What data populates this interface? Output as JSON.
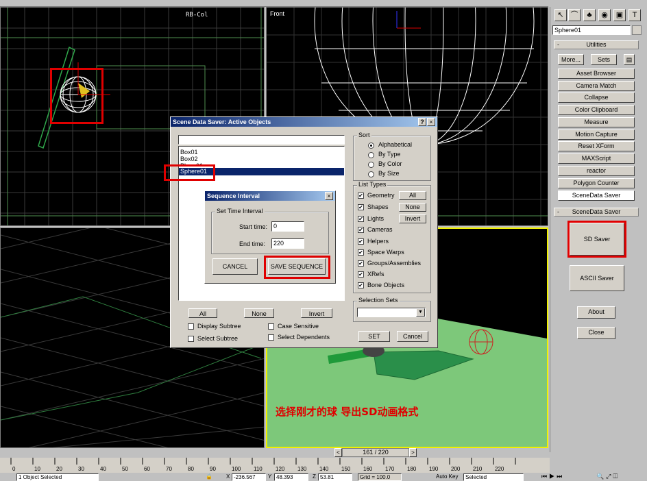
{
  "viewports": {
    "top": {
      "label": "RB-Col"
    },
    "front": {
      "label": "Front"
    }
  },
  "command_panel": {
    "object_name": "Sphere01",
    "utilities_rollout": "Utilities",
    "more_button": "More...",
    "sets_button": "Sets",
    "utility_buttons": [
      "Asset Browser",
      "Camera Match",
      "Collapse",
      "Color Clipboard",
      "Measure",
      "Motion Capture",
      "Reset XForm",
      "MAXScript",
      "reactor",
      "Polygon Counter",
      "SceneData Saver"
    ],
    "scenedata_rollout": "SceneData Saver",
    "sd_saver": "SD Saver",
    "ascii_saver": "ASCII Saver",
    "about": "About",
    "close": "Close",
    "minus": "-"
  },
  "dialog": {
    "title": "Scene Data Saver: Active Objects",
    "help": "?",
    "close": "×",
    "objects": [
      "Box01",
      "Box02",
      "Sphere01"
    ],
    "hidden_item": "Plane01",
    "all_btn": "All",
    "none_btn": "None",
    "invert_btn": "Invert",
    "display_subtree": "Display Subtree",
    "select_subtree": "Select Subtree",
    "case_sensitive": "Case Sensitive",
    "select_dependents": "Select Dependents",
    "sort_label": "Sort",
    "sort_options": [
      "Alphabetical",
      "By Type",
      "By Color",
      "By Size"
    ],
    "list_types_label": "List Types",
    "list_types": [
      "Geometry",
      "Shapes",
      "Lights",
      "Cameras",
      "Helpers",
      "Space Warps",
      "Groups/Assemblies",
      "XRefs",
      "Bone Objects"
    ],
    "lt_all": "All",
    "lt_none": "None",
    "lt_invert": "Invert",
    "selection_sets_label": "Selection Sets",
    "set_btn": "SET",
    "cancel_btn": "Cancel",
    "check": "✔"
  },
  "sequence": {
    "title": "Sequence Interval",
    "close": "×",
    "group_label": "Set Time Interval",
    "start_label": "Start time:",
    "start_value": "0",
    "end_label": "End time:",
    "end_value": "220",
    "cancel": "CANCEL",
    "save": "SAVE SEQUENCE"
  },
  "annotation": "选择刚才的球 导出SD动画格式",
  "timeline": {
    "counter": "161 / 220",
    "ticks": [
      "0",
      "10",
      "20",
      "30",
      "40",
      "50",
      "60",
      "70",
      "80",
      "90",
      "100",
      "110",
      "120",
      "130",
      "140",
      "150",
      "160",
      "170",
      "180",
      "190",
      "200",
      "210",
      "220"
    ]
  },
  "status": {
    "selected": "1 Object Selected",
    "x_label": "X",
    "x": "-236.567",
    "y_label": "Y",
    "y": "48.393",
    "z_label": "Z",
    "z": "53.81",
    "grid": "Grid = 100.0",
    "autokey": "Auto Key",
    "selected_dropdown": "Selected"
  },
  "colors": {
    "accent_red": "#e00000",
    "title_blue": "#0a246a",
    "ground_green": "#7dc87a"
  }
}
